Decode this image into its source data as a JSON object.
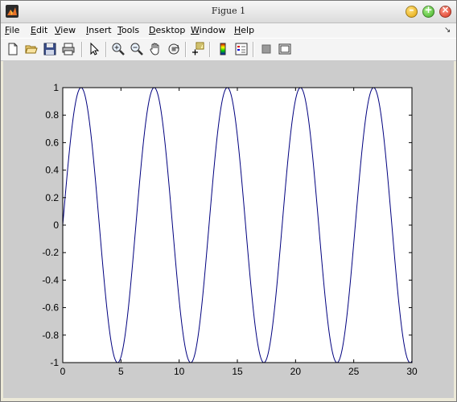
{
  "window": {
    "title": "Figue 1"
  },
  "menu": [
    {
      "label": "File",
      "mnemonic": "F"
    },
    {
      "label": "Edit",
      "mnemonic": "E"
    },
    {
      "label": "View",
      "mnemonic": "V"
    },
    {
      "label": "Insert",
      "mnemonic": "I"
    },
    {
      "label": "Tools",
      "mnemonic": "T"
    },
    {
      "label": "Desktop",
      "mnemonic": "D"
    },
    {
      "label": "Window",
      "mnemonic": "W"
    },
    {
      "label": "Help",
      "mnemonic": "H"
    }
  ],
  "toolbar": [
    "new-figure-icon",
    "open-file-icon",
    "save-icon",
    "print-icon",
    "edit-plot-arrow-icon",
    "zoom-in-icon",
    "zoom-out-icon",
    "pan-hand-icon",
    "rotate-3d-icon",
    "data-cursor-icon",
    "colorbar-icon",
    "legend-icon",
    "hide-plot-tools-icon",
    "show-plot-tools-icon"
  ],
  "chart_data": {
    "type": "line",
    "function": "sin(x)",
    "x_range": [
      0,
      30
    ],
    "xlim": [
      0,
      30
    ],
    "ylim": [
      -1,
      1
    ],
    "xticks": [
      "0",
      "5",
      "10",
      "15",
      "20",
      "25",
      "30"
    ],
    "yticks": [
      "1",
      "0.8",
      "0.6",
      "0.4",
      "0.2",
      "0",
      "-0.2",
      "-0.4",
      "-0.6",
      "-0.8",
      "-1"
    ],
    "xtick_values": [
      0,
      5,
      10,
      15,
      20,
      25,
      30
    ],
    "ytick_values": [
      1,
      0.8,
      0.6,
      0.4,
      0.2,
      0,
      -0.2,
      -0.4,
      -0.6,
      -0.8,
      -1
    ],
    "series": [
      {
        "color": "#00007f",
        "x": [
          0,
          0.5,
          1,
          1.5,
          2,
          2.5,
          3,
          3.5,
          4,
          4.5,
          5,
          5.5,
          6,
          6.5,
          7,
          7.5,
          8,
          8.5,
          9,
          9.5,
          10,
          10.5,
          11,
          11.5,
          12,
          12.5,
          13,
          13.5,
          14,
          14.5,
          15,
          15.5,
          16,
          16.5,
          17,
          17.5,
          18,
          18.5,
          19,
          19.5,
          20,
          20.5,
          21,
          21.5,
          22,
          22.5,
          23,
          23.5,
          24,
          24.5,
          25,
          25.5,
          26,
          26.5,
          27,
          27.5,
          28,
          28.5,
          29,
          29.5,
          30
        ],
        "y": [
          0,
          0.479,
          0.841,
          0.997,
          0.909,
          0.598,
          0.141,
          -0.351,
          -0.757,
          -0.978,
          -0.959,
          -0.706,
          -0.279,
          0.215,
          0.657,
          0.938,
          0.989,
          0.798,
          0.412,
          -0.075,
          -0.544,
          -0.88,
          -1.0,
          -0.875,
          -0.537,
          -0.066,
          0.42,
          0.804,
          0.991,
          0.935,
          0.65,
          0.207,
          -0.288,
          -0.712,
          -0.961,
          -0.976,
          -0.751,
          -0.342,
          0.15,
          0.605,
          0.913,
          0.997,
          0.837,
          0.472,
          -0.009,
          -0.487,
          -0.846,
          -0.998,
          -0.906,
          -0.591,
          -0.132,
          0.36,
          0.763,
          0.98,
          0.956,
          0.699,
          0.271,
          -0.224,
          -0.664,
          -0.94,
          -0.988
        ]
      }
    ]
  }
}
